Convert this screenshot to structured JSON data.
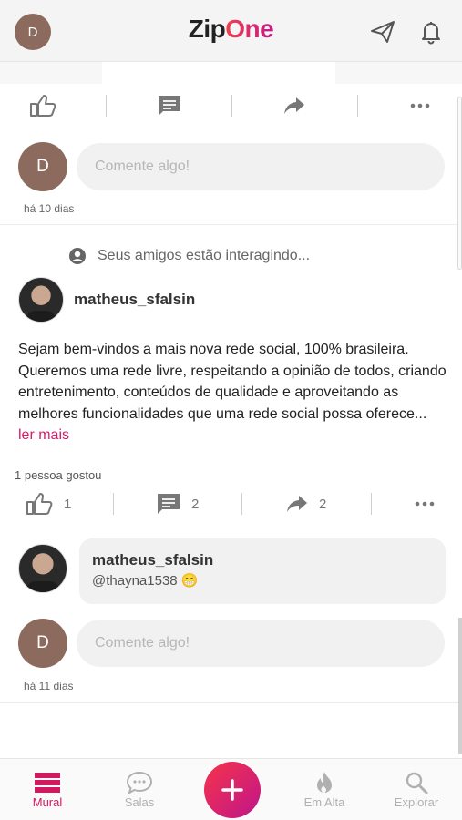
{
  "header": {
    "avatar_initial": "D",
    "logo_part1": "Zip",
    "logo_part2": "One",
    "brand_color": "#e8356d"
  },
  "post1": {
    "comment_avatar": "D",
    "comment_placeholder": "Comente algo!",
    "time_ago": "há 10 dias"
  },
  "post2": {
    "activity_text": "Seus amigos estão interagindo...",
    "author": "matheus_sfalsin",
    "text": "Sejam bem-vindos a mais nova rede social, 100% brasileira. Queremos uma rede livre, respeitando a opinião de todos, criando entretenimento, conteúdos de qualidade e aproveitando as melhores funcionalidades que uma rede social possa oferece...",
    "read_more": "ler mais",
    "likes_text": "1 pessoa gostou",
    "like_count": "1",
    "comment_count": "2",
    "share_count": "2",
    "reply": {
      "author": "matheus_sfalsin",
      "text": "@thayna1538 😁"
    },
    "comment_avatar": "D",
    "comment_placeholder": "Comente algo!",
    "time_ago": "há 11 dias"
  },
  "bottom_nav": [
    {
      "label": "Mural",
      "icon": "mural-icon",
      "active": true
    },
    {
      "label": "Salas",
      "icon": "chat-bubble-icon",
      "active": false
    },
    {
      "label": "Em Alta",
      "icon": "flame-icon",
      "active": false
    },
    {
      "label": "Explorar",
      "icon": "search-icon",
      "active": false
    }
  ]
}
